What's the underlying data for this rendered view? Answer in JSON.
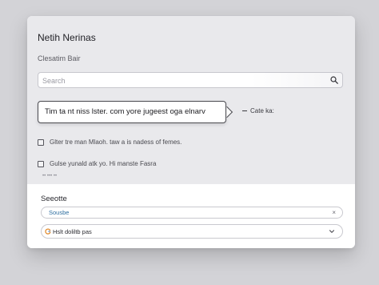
{
  "header": {
    "title": "Netih Nerinas",
    "subtitle": "Clesatim Bair"
  },
  "search": {
    "placeholder": "Search",
    "value": ""
  },
  "tooltip": {
    "text": "Tim ta nt niss lster. com yore jugeest oga elnarv",
    "side_label": "Cate ka:"
  },
  "options": [
    {
      "label": "Glter tre man Mlaoh. taw a is nadess of femes."
    },
    {
      "label": "Gulse yunald atk yo.  Hi manste Fasra"
    }
  ],
  "note": "•• ••• ••",
  "lower": {
    "section_label": "Seeotte",
    "field1_value": "Sousbe",
    "field2_value": "Hslt doliltb pas"
  },
  "colors": {
    "background": "#d3d3d7",
    "card": "#e9e9ec",
    "accent_text": "#2f6fa0"
  },
  "icons": {
    "search": "search-icon",
    "clear": "close-icon",
    "chevron": "chevron-down-icon",
    "source": "g-logo-icon"
  }
}
